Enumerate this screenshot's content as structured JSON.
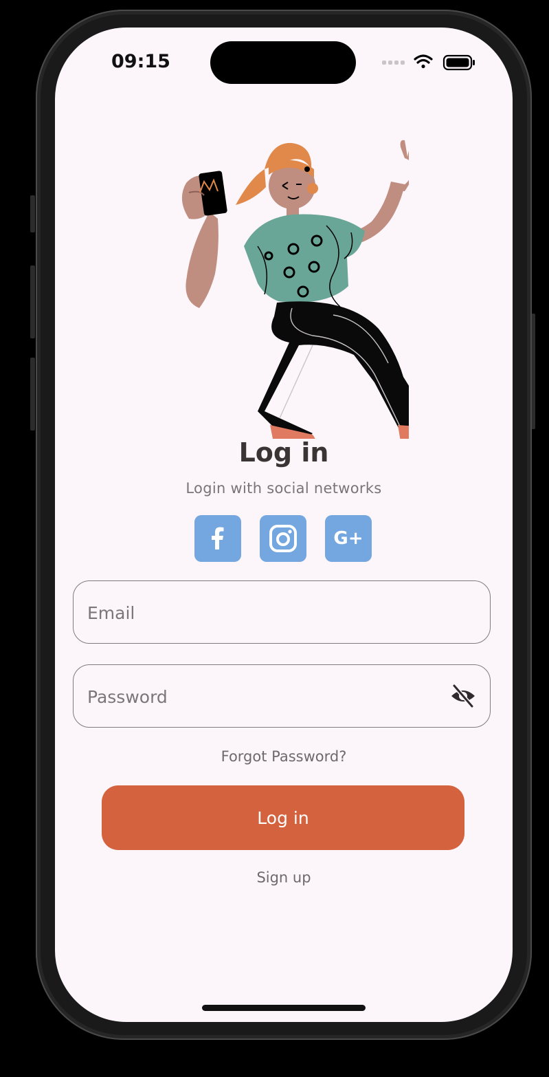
{
  "status_bar": {
    "time": "09:15"
  },
  "header": {
    "title": "Log in",
    "subtitle": "Login with social networks"
  },
  "social": [
    {
      "name": "facebook",
      "icon": "facebook-icon"
    },
    {
      "name": "instagram",
      "icon": "instagram-icon"
    },
    {
      "name": "google-plus",
      "icon": "google-plus-icon",
      "label": "G+"
    }
  ],
  "form": {
    "email_placeholder": "Email",
    "password_placeholder": "Password",
    "forgot_label": "Forgot Password?",
    "login_label": "Log in",
    "signup_label": "Sign up"
  },
  "colors": {
    "background": "#fcf6fb",
    "accent": "#d4623e",
    "social": "#74a6e0"
  }
}
